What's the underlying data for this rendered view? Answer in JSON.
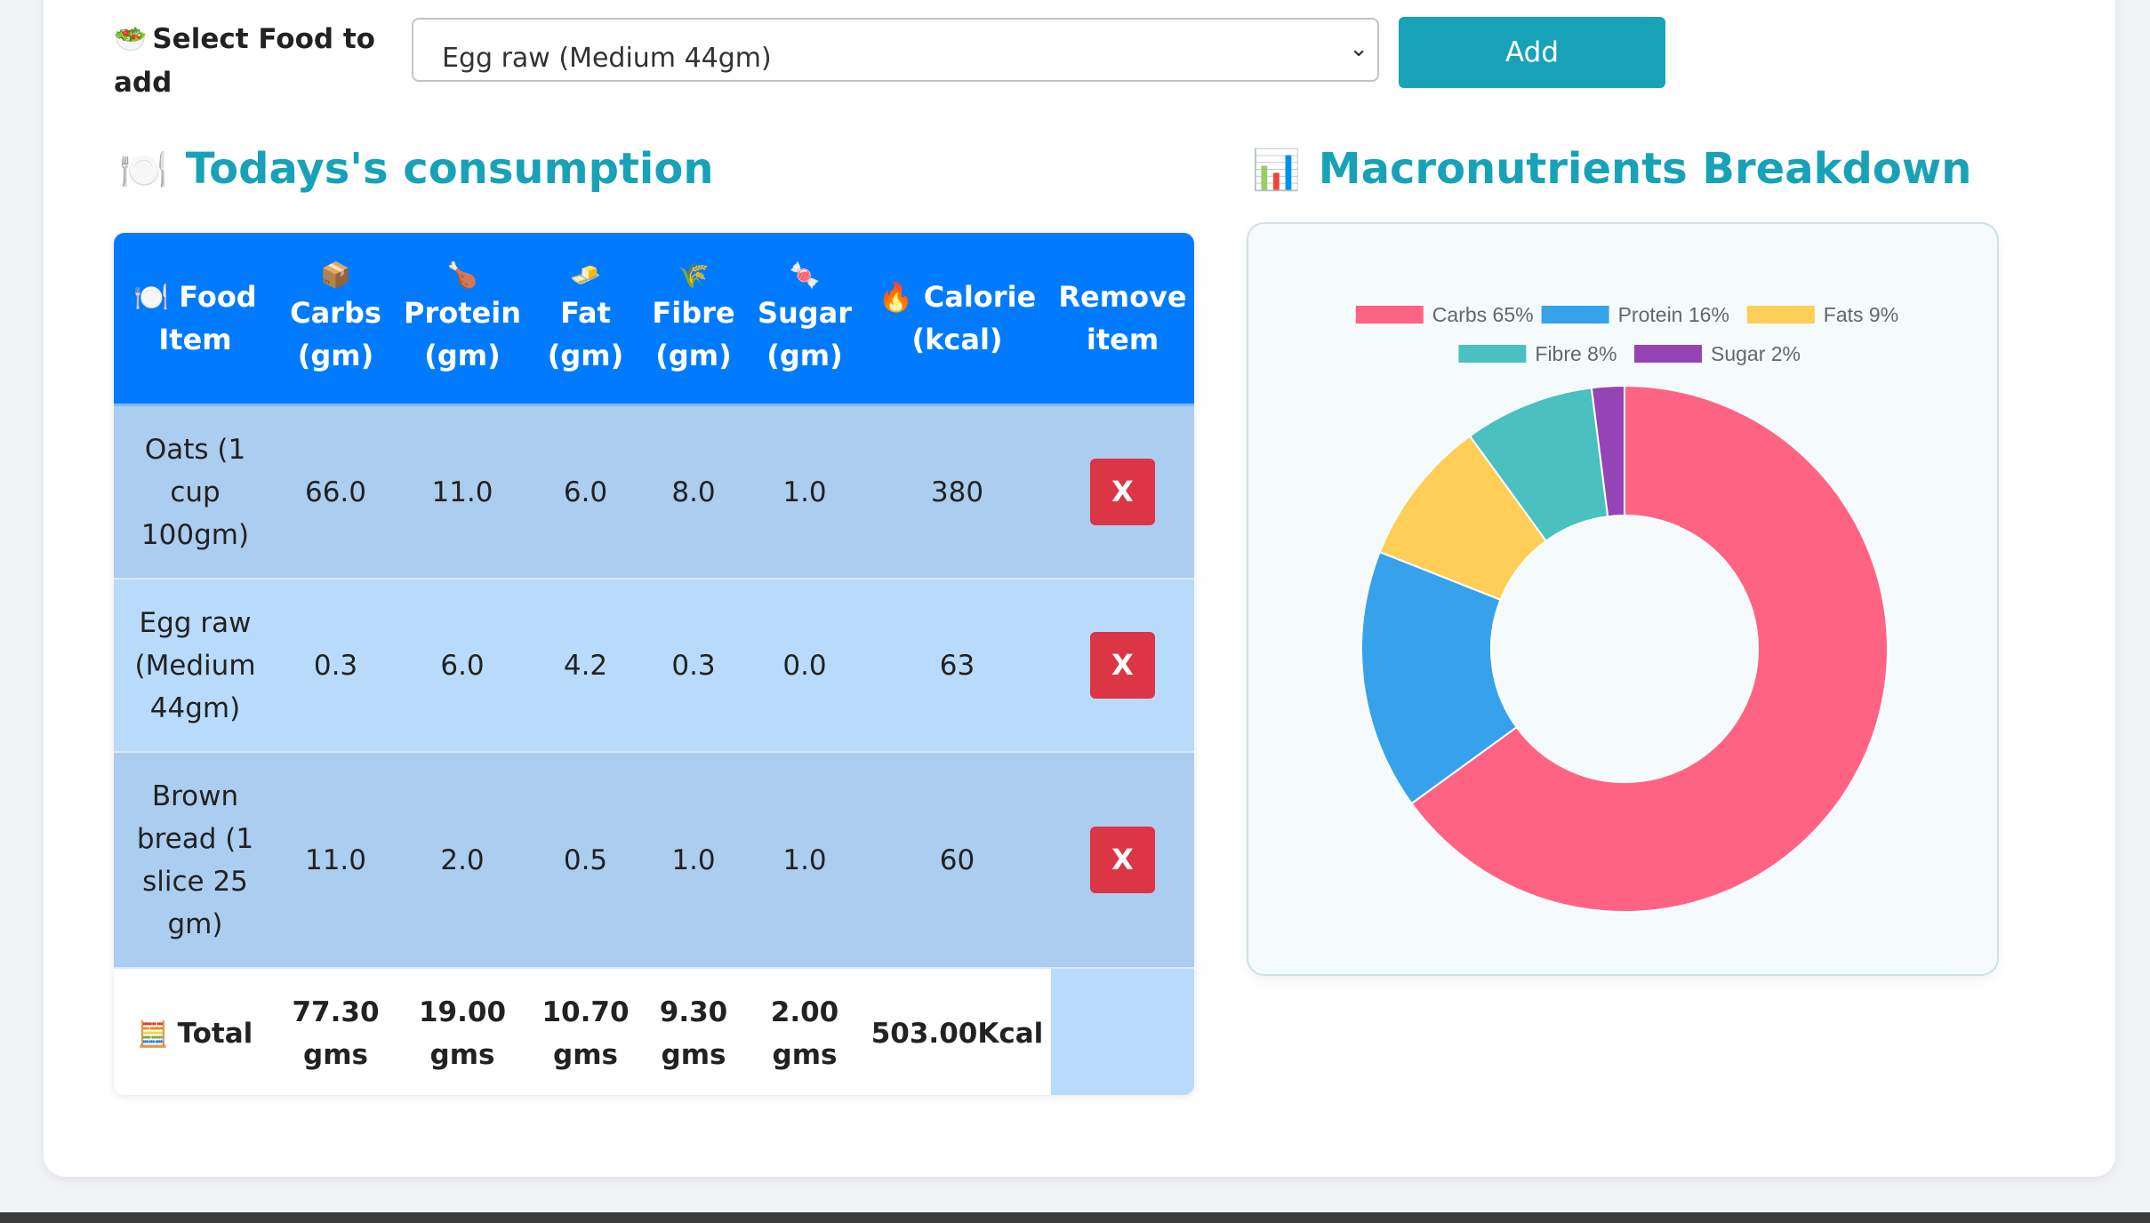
{
  "select_section": {
    "label_icon": "salad-icon",
    "label": "Select Food to add",
    "selected_food": "Egg raw (Medium 44gm)",
    "add_button": "Add"
  },
  "consumption": {
    "icon": "plate-icon",
    "title": "Todays's consumption",
    "columns": [
      {
        "icon": "plate-icon",
        "label": "Food Item"
      },
      {
        "icon": "box-icon",
        "label": "Carbs (gm)"
      },
      {
        "icon": "drumstick-icon",
        "label": "Protein (gm)"
      },
      {
        "icon": "butter-icon",
        "label": "Fat (gm)"
      },
      {
        "icon": "wheat-icon",
        "label": "Fibre (gm)"
      },
      {
        "icon": "candy-icon",
        "label": "Sugar (gm)"
      },
      {
        "icon": "fire-icon",
        "label": "Calorie (kcal)"
      },
      {
        "icon": "",
        "label": "Remove item"
      }
    ],
    "rows": [
      {
        "food": "Oats (1 cup 100gm)",
        "carbs": "66.0",
        "protein": "11.0",
        "fat": "6.0",
        "fibre": "8.0",
        "sugar": "1.0",
        "calorie": "380",
        "remove": "X"
      },
      {
        "food": "Egg raw (Medium 44gm)",
        "carbs": "0.3",
        "protein": "6.0",
        "fat": "4.2",
        "fibre": "0.3",
        "sugar": "0.0",
        "calorie": "63",
        "remove": "X"
      },
      {
        "food": "Brown bread (1 slice 25 gm)",
        "carbs": "11.0",
        "protein": "2.0",
        "fat": "0.5",
        "fibre": "1.0",
        "sugar": "1.0",
        "calorie": "60",
        "remove": "X"
      }
    ],
    "total": {
      "icon": "abacus-icon",
      "label": "Total",
      "carbs": "77.30 gms",
      "protein": "19.00 gms",
      "fat": "10.70 gms",
      "fibre": "9.30 gms",
      "sugar": "2.00 gms",
      "calorie": "503.00Kcal"
    }
  },
  "macros": {
    "icon": "bar-chart-icon",
    "title": "Macronutrients Breakdown"
  },
  "chart_data": {
    "type": "pie",
    "variant": "doughnut",
    "categories": [
      "Carbs 65%",
      "Protein 16%",
      "Fats 9%",
      "Fibre 8%",
      "Sugar 2%"
    ],
    "values": [
      65,
      16,
      9,
      8,
      2
    ],
    "colors": [
      "#ff6384",
      "#36a2eb",
      "#ffce56",
      "#4bc0c0",
      "#9544b5"
    ],
    "legend": "top",
    "title": ""
  }
}
